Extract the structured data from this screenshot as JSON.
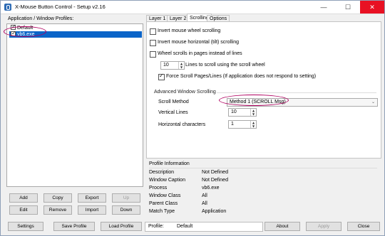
{
  "window": {
    "title": "X-Mouse Button Control - Setup v2.16",
    "controls": {
      "minimize": "—",
      "maximize": "☐",
      "close": "✕"
    }
  },
  "profiles": {
    "label": "Application / Window Profiles:",
    "items": [
      {
        "label": "Default",
        "checked": true,
        "selected": false
      },
      {
        "label": "vb6.exe",
        "checked": true,
        "selected": true
      }
    ]
  },
  "left_buttons": {
    "add": "Add",
    "copy": "Copy",
    "export": "Export",
    "up": "Up",
    "edit": "Edit",
    "remove": "Remove",
    "import": "Import",
    "down": "Down"
  },
  "tabs": [
    "Layer 1",
    "Layer 2",
    "Scrolling",
    "Options"
  ],
  "active_tab": "Scrolling",
  "scrolling": {
    "invert_wheel": "Invert mouse wheel scrolling",
    "invert_tilt": "Invert mouse horizontal (tilt) scrolling",
    "wheel_pages": "Wheel scrolls in pages instead of lines",
    "lines_value": "10",
    "lines_label": "Lines to scroll using the scroll wheel",
    "force_label": "Force Scroll Pages/Lines (If application does not respond to setting)",
    "advanced_title": "Advanced Window Scrolling",
    "scroll_method_label": "Scroll Method",
    "scroll_method_value": "Method 1 (SCROLL Msg)",
    "vertical_lines_label": "Vertical Lines",
    "vertical_lines_value": "10",
    "horizontal_chars_label": "Horizontal characters",
    "horizontal_chars_value": "1"
  },
  "profile_info": {
    "title": "Profile Information",
    "rows": [
      {
        "key": "Description",
        "value": "Not Defined"
      },
      {
        "key": "Window Caption",
        "value": "Not Defined"
      },
      {
        "key": "Process",
        "value": "vb6.exe"
      },
      {
        "key": "Window Class",
        "value": "All"
      },
      {
        "key": "Parent Class",
        "value": "All"
      },
      {
        "key": "Match Type",
        "value": "Application"
      }
    ]
  },
  "bottom": {
    "settings": "Settings",
    "save_profile": "Save Profile",
    "load_profile": "Load Profile",
    "profile_label": "Profile:",
    "profile_value": "Default",
    "about": "About",
    "apply": "Apply",
    "close": "Close"
  },
  "colors": {
    "selection": "#0a64c8",
    "annotation": "#b00060",
    "close_button": "#e81123"
  }
}
